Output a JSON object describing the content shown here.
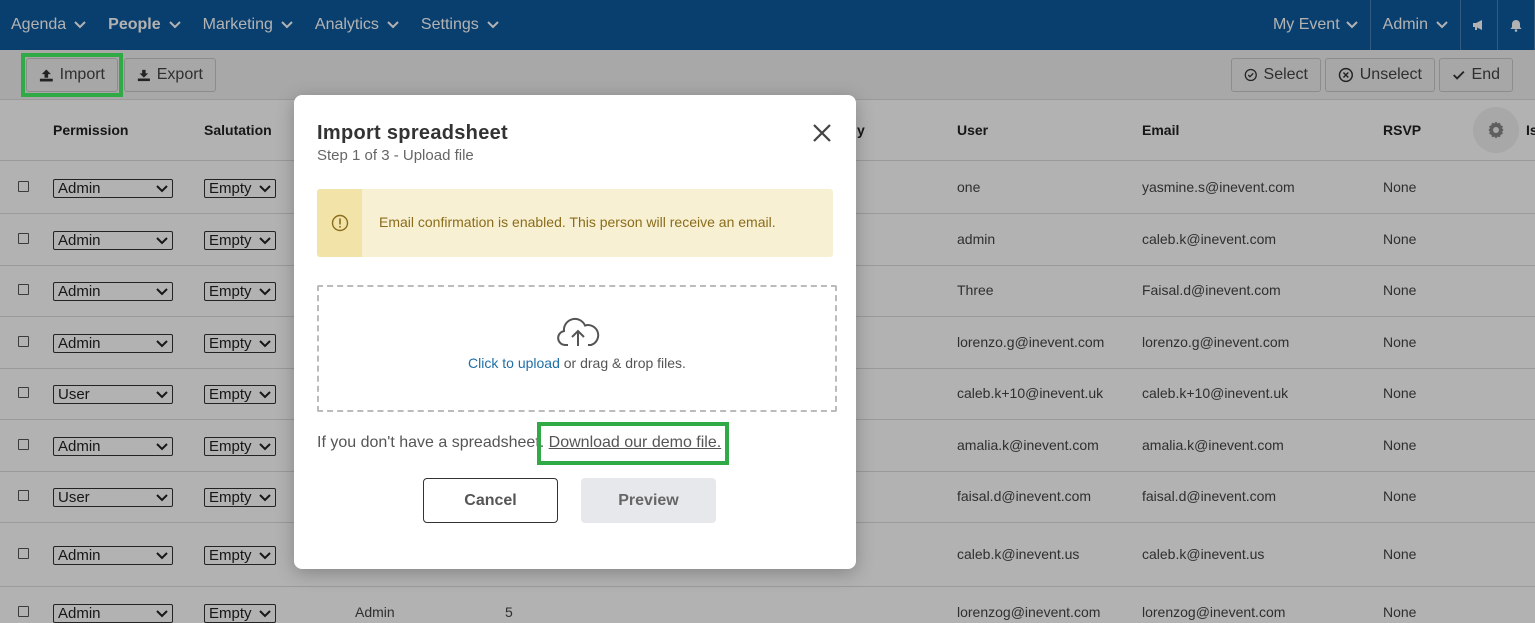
{
  "nav": {
    "items": [
      {
        "label": "Agenda",
        "active": false
      },
      {
        "label": "People",
        "active": true
      },
      {
        "label": "Marketing",
        "active": false
      },
      {
        "label": "Analytics",
        "active": false
      },
      {
        "label": "Settings",
        "active": false
      }
    ],
    "event_label": "My Event",
    "admin_label": "Admin",
    "icons": [
      "megaphone-icon",
      "bell-icon"
    ]
  },
  "toolbar": {
    "import_label": "Import",
    "export_label": "Export",
    "select_label": "Select",
    "unselect_label": "Unselect",
    "end_label": "End"
  },
  "table": {
    "headers": {
      "permission": "Permission",
      "salutation": "Salutation",
      "partial": "y",
      "user": "User",
      "email": "Email",
      "rsvp": "RSVP",
      "extra": "Is"
    },
    "rows": [
      {
        "permission": "Admin",
        "salutation": "Empty",
        "user": "one",
        "email": "yasmine.s@inevent.com",
        "rsvp": "None"
      },
      {
        "permission": "Admin",
        "salutation": "Empty",
        "user": "admin",
        "email": "caleb.k@inevent.com",
        "rsvp": "None"
      },
      {
        "permission": "Admin",
        "salutation": "Empty",
        "user": "Three",
        "email": "Faisal.d@inevent.com",
        "rsvp": "None"
      },
      {
        "permission": "Admin",
        "salutation": "Empty",
        "user": "lorenzo.g@inevent.com",
        "email": "lorenzo.g@inevent.com",
        "rsvp": "None"
      },
      {
        "permission": "User",
        "salutation": "Empty",
        "user": "caleb.k+10@inevent.uk",
        "email": "caleb.k+10@inevent.uk",
        "rsvp": "None"
      },
      {
        "permission": "Admin",
        "salutation": "Empty",
        "user": "amalia.k@inevent.com",
        "email": "amalia.k@inevent.com",
        "rsvp": "None"
      },
      {
        "permission": "User",
        "salutation": "Empty",
        "user": "faisal.d@inevent.com",
        "email": "faisal.d@inevent.com",
        "rsvp": "None"
      },
      {
        "permission": "Admin",
        "salutation": "Empty",
        "user": "caleb.k@inevent.us",
        "email": "caleb.k@inevent.us",
        "rsvp": "None"
      },
      {
        "permission": "Admin",
        "salutation": "Empty",
        "role": "Admin",
        "count": "5",
        "user": "lorenzog@inevent.com",
        "email": "lorenzog@inevent.com",
        "rsvp": "None"
      }
    ]
  },
  "modal": {
    "title": "Import spreadsheet",
    "subtitle": "Step 1 of 3 - Upload file",
    "alert": "Email confirmation is enabled. This person will receive an email.",
    "upload_link": "Click to upload",
    "upload_rest": " or drag & drop files.",
    "demo_prefix": "If you don't have a spreadsheet. ",
    "demo_link": "Download our demo file.",
    "cancel_label": "Cancel",
    "preview_label": "Preview"
  },
  "colors": {
    "nav_bg": "#0d5ba0",
    "highlight": "#2faa45",
    "alert_bg": "#f8f0d2",
    "link": "#1f6fa6"
  }
}
